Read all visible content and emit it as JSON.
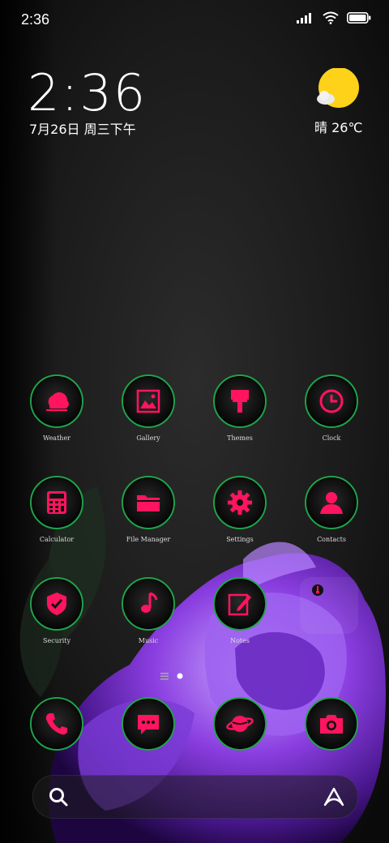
{
  "status_bar": {
    "time": "2:36"
  },
  "clock": {
    "time": "2:36",
    "date": "7月26日 周三下午"
  },
  "weather": {
    "text": "晴 26℃",
    "icon": "sun-with-cloud-icon"
  },
  "accent_color": "#ff1460",
  "ring_color": "#1fa24a",
  "home_apps": [
    {
      "label": "Weather",
      "icon": "weather-cloud-icon"
    },
    {
      "label": "Gallery",
      "icon": "gallery-icon"
    },
    {
      "label": "Themes",
      "icon": "paintbrush-icon"
    },
    {
      "label": "Clock",
      "icon": "clock-icon"
    },
    {
      "label": "Calculator",
      "icon": "calculator-icon"
    },
    {
      "label": "File Manager",
      "icon": "folder-icon"
    },
    {
      "label": "Settings",
      "icon": "gear-icon"
    },
    {
      "label": "Contacts",
      "icon": "contact-person-icon"
    },
    {
      "label": "Security",
      "icon": "shield-check-icon"
    },
    {
      "label": "Music",
      "icon": "music-note-icon"
    },
    {
      "label": "Notes",
      "icon": "edit-pencil-icon"
    }
  ],
  "dock": [
    {
      "icon": "phone-icon"
    },
    {
      "icon": "message-bubble-icon"
    },
    {
      "icon": "planet-browser-icon"
    },
    {
      "icon": "camera-icon"
    }
  ],
  "search": {
    "icon": "search-icon",
    "assistant_icon": "assistant-a-icon"
  }
}
